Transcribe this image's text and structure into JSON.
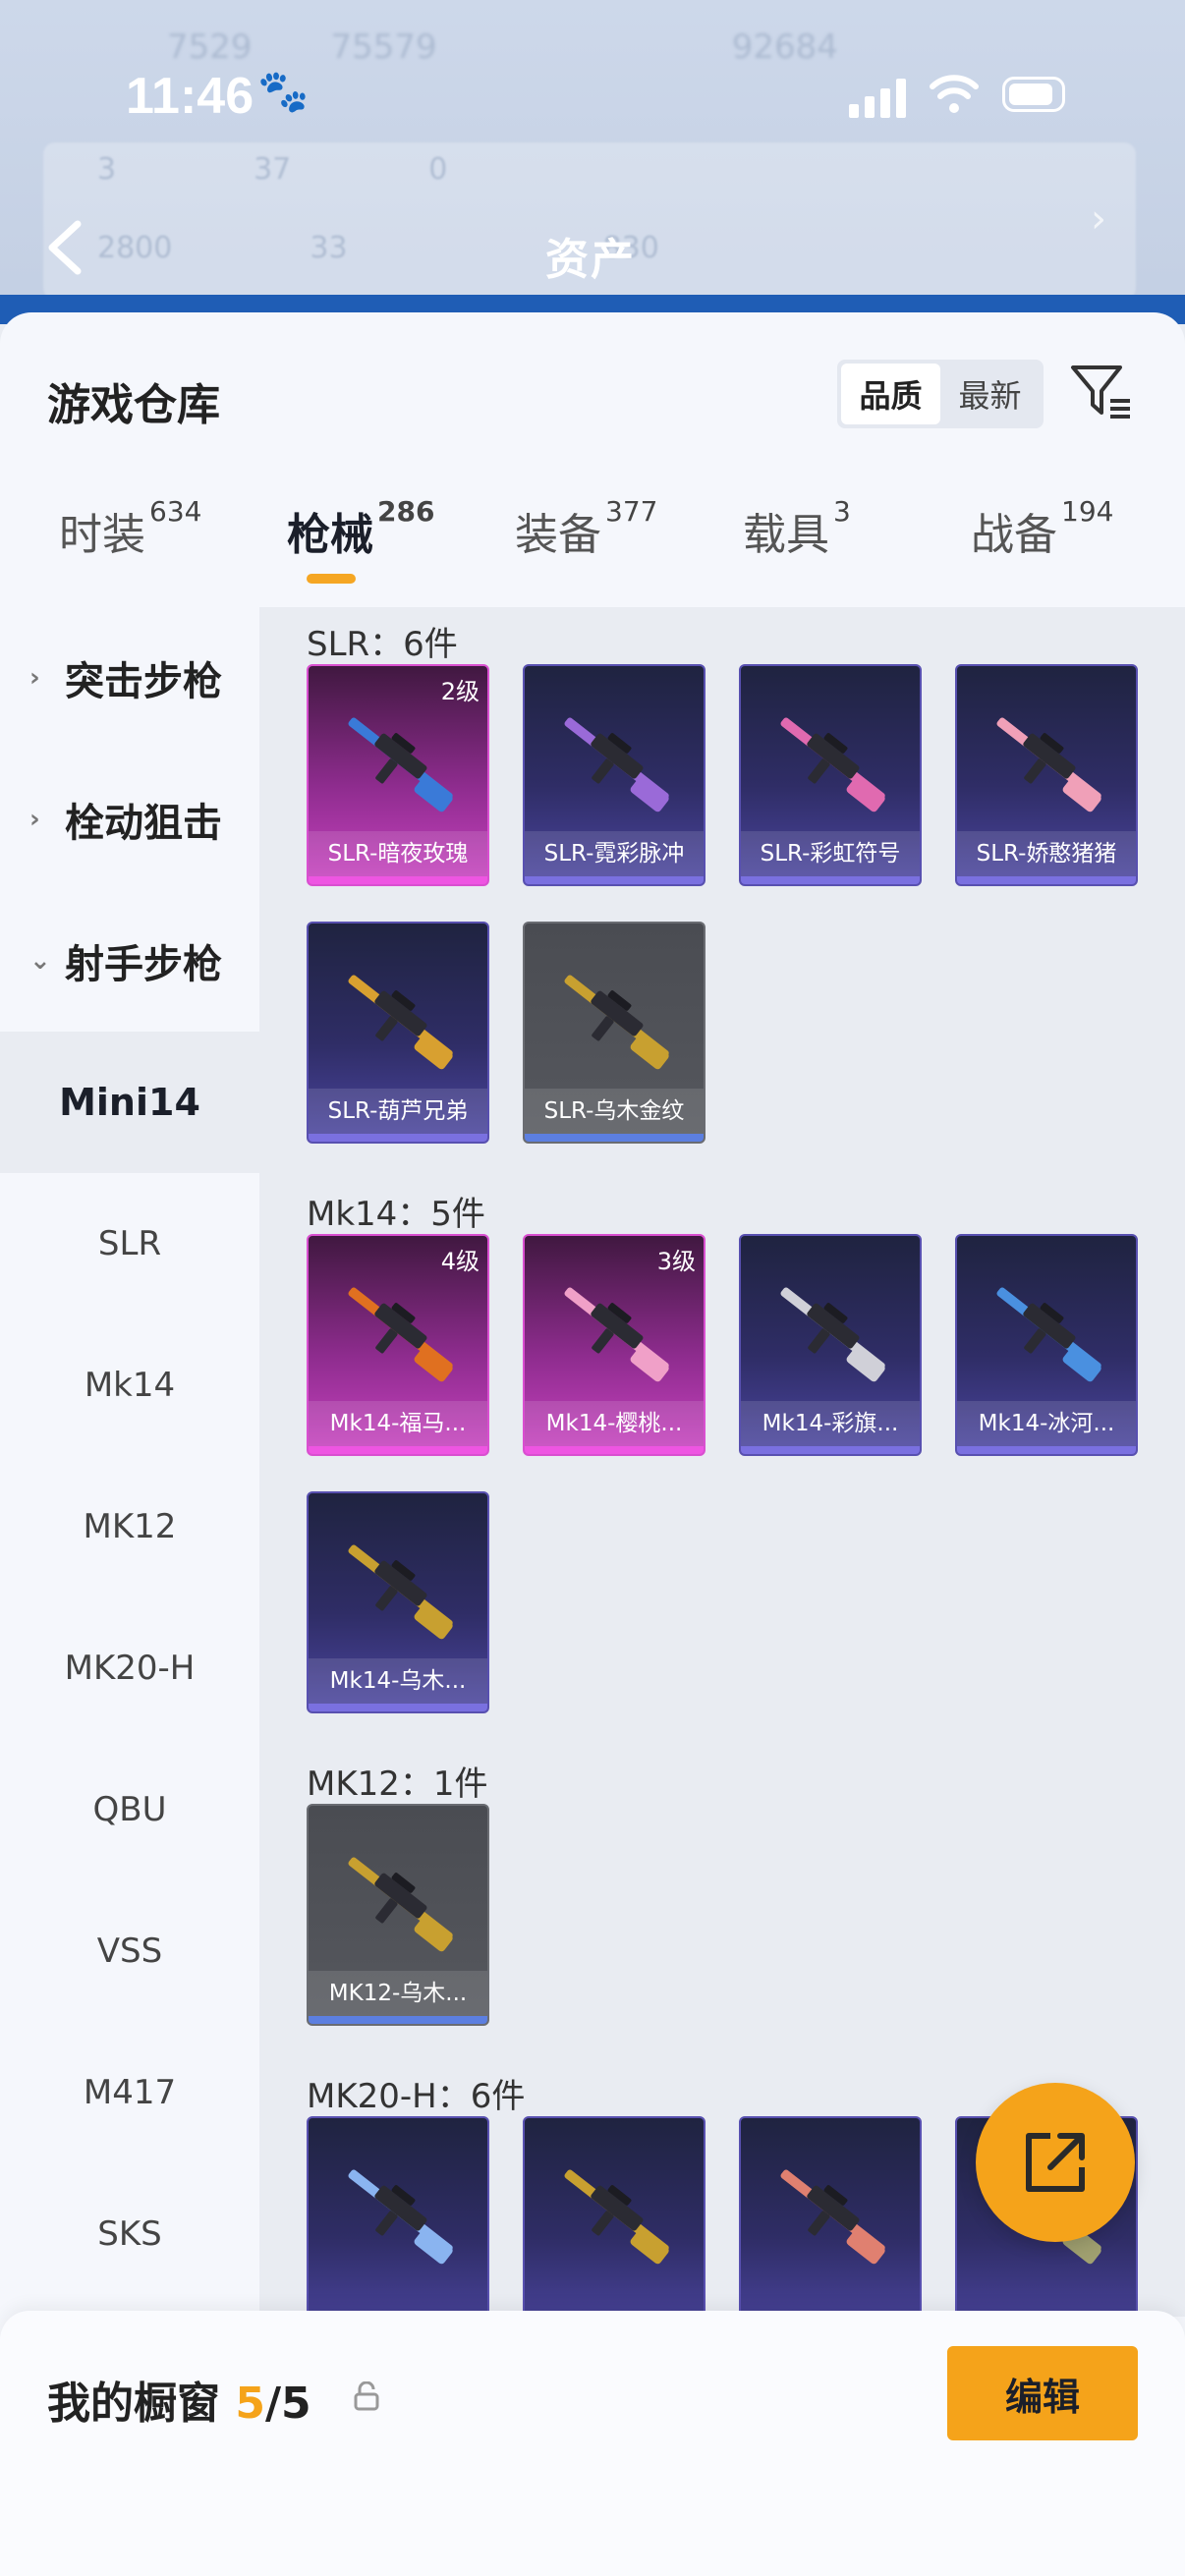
{
  "status_bar": {
    "time": "11:46"
  },
  "background": {
    "stats_row1": [
      "7529",
      "75579",
      "92684"
    ],
    "panel_row1": [
      "3",
      "37",
      "0"
    ],
    "panel_row2": [
      "2800",
      "33",
      "830"
    ],
    "title": "资产"
  },
  "sheet": {
    "title": "游戏仓库",
    "sort_options": [
      "品质",
      "最新"
    ],
    "sort_active": "品质"
  },
  "tabs": [
    {
      "label": "时装",
      "count": "634"
    },
    {
      "label": "枪械",
      "count": "286"
    },
    {
      "label": "装备",
      "count": "377"
    },
    {
      "label": "载具",
      "count": "3"
    },
    {
      "label": "战备",
      "count": "194"
    }
  ],
  "sidebar": {
    "categories": [
      "突击步枪",
      "栓动狙击",
      "射手步枪"
    ],
    "subitems": [
      "Mini14",
      "SLR",
      "Mk14",
      "MK12",
      "MK20-H",
      "QBU",
      "VSS",
      "M417",
      "SKS"
    ],
    "active_subitem": "Mini14"
  },
  "groups": [
    {
      "title": "SLR：6件",
      "items": [
        {
          "name": "SLR-暗夜玫瑰",
          "level": "2级",
          "tier": "pink",
          "accent": "#3a7ad8"
        },
        {
          "name": "SLR-霓彩脉冲",
          "level": "",
          "tier": "purple",
          "accent": "#9a6ad8"
        },
        {
          "name": "SLR-彩虹符号",
          "level": "",
          "tier": "purple",
          "accent": "#e06ab0"
        },
        {
          "name": "SLR-娇憨猪猪",
          "level": "",
          "tier": "purple",
          "accent": "#f0a0b8"
        },
        {
          "name": "SLR-葫芦兄弟",
          "level": "",
          "tier": "purple",
          "accent": "#d8a030"
        },
        {
          "name": "SLR-乌木金纹",
          "level": "",
          "tier": "grey",
          "accent": "#c8a030"
        }
      ]
    },
    {
      "title": "Mk14：5件",
      "items": [
        {
          "name": "Mk14-福马...",
          "level": "4级",
          "tier": "pink",
          "accent": "#e07020"
        },
        {
          "name": "Mk14-樱桃...",
          "level": "3级",
          "tier": "pink",
          "accent": "#f0a0c8"
        },
        {
          "name": "Mk14-彩旗...",
          "level": "",
          "tier": "purple",
          "accent": "#d0d0d8"
        },
        {
          "name": "Mk14-冰河...",
          "level": "",
          "tier": "purple",
          "accent": "#4a90e0"
        },
        {
          "name": "Mk14-乌木...",
          "level": "",
          "tier": "purple",
          "accent": "#c8a030"
        }
      ]
    },
    {
      "title": "MK12：1件",
      "items": [
        {
          "name": "MK12-乌木...",
          "level": "",
          "tier": "grey",
          "accent": "#c8a030"
        }
      ]
    },
    {
      "title": "MK20-H：6件",
      "items": [
        {
          "name": "",
          "level": "",
          "tier": "purple",
          "accent": "#8ab4f0"
        },
        {
          "name": "",
          "level": "",
          "tier": "purple",
          "accent": "#c8a030"
        },
        {
          "name": "",
          "level": "",
          "tier": "purple",
          "accent": "#e08070"
        },
        {
          "name": "",
          "level": "",
          "tier": "purple",
          "accent": "#a0a070"
        }
      ]
    }
  ],
  "bottom": {
    "label": "我的橱窗",
    "count": "5",
    "separator_total": "/5",
    "edit_label": "编辑"
  },
  "colors": {
    "accent": "#f5a31a",
    "active_tab_underline": "#f5a623"
  }
}
